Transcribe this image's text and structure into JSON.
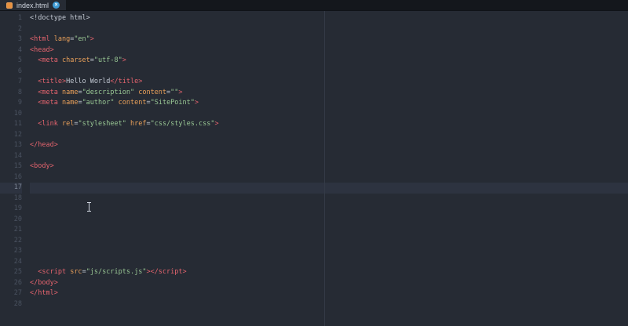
{
  "window": {
    "tab": {
      "title": "index.html",
      "icon": "html-file-icon",
      "close_glyph": "×"
    }
  },
  "editor": {
    "current_line": 17,
    "colors": {
      "plain": "#c2c8d2",
      "tag": "#e5646e",
      "attr": "#e9a05a",
      "string": "#99c794",
      "gutter": "#4a5260",
      "line_highlight": "#2d3340",
      "tab_close_blue": "#3e9bd5",
      "file_icon_orange": "#e8913f"
    },
    "lines": [
      {
        "n": 1,
        "s": [
          [
            "plain",
            "<!doctype html>"
          ]
        ]
      },
      {
        "n": 2,
        "s": []
      },
      {
        "n": 3,
        "s": [
          [
            "tag",
            "<html"
          ],
          [
            "attr",
            " lang"
          ],
          [
            "plain",
            "="
          ],
          [
            "string",
            "\"en\""
          ],
          [
            "tag",
            ">"
          ]
        ]
      },
      {
        "n": 4,
        "s": [
          [
            "tag",
            "<head>"
          ]
        ]
      },
      {
        "n": 5,
        "s": [
          [
            "plain",
            "  "
          ],
          [
            "tag",
            "<meta"
          ],
          [
            "attr",
            " charset"
          ],
          [
            "plain",
            "="
          ],
          [
            "string",
            "\"utf-8\""
          ],
          [
            "tag",
            ">"
          ]
        ]
      },
      {
        "n": 6,
        "s": []
      },
      {
        "n": 7,
        "s": [
          [
            "plain",
            "  "
          ],
          [
            "tag",
            "<title>"
          ],
          [
            "plain",
            "Hello World"
          ],
          [
            "tag",
            "</title>"
          ]
        ]
      },
      {
        "n": 8,
        "s": [
          [
            "plain",
            "  "
          ],
          [
            "tag",
            "<meta"
          ],
          [
            "attr",
            " name"
          ],
          [
            "plain",
            "="
          ],
          [
            "string",
            "\"description\""
          ],
          [
            "attr",
            " content"
          ],
          [
            "plain",
            "="
          ],
          [
            "string",
            "\"\""
          ],
          [
            "tag",
            ">"
          ]
        ]
      },
      {
        "n": 9,
        "s": [
          [
            "plain",
            "  "
          ],
          [
            "tag",
            "<meta"
          ],
          [
            "attr",
            " name"
          ],
          [
            "plain",
            "="
          ],
          [
            "string",
            "\"author\""
          ],
          [
            "attr",
            " content"
          ],
          [
            "plain",
            "="
          ],
          [
            "string",
            "\"SitePoint\""
          ],
          [
            "tag",
            ">"
          ]
        ]
      },
      {
        "n": 10,
        "s": []
      },
      {
        "n": 11,
        "s": [
          [
            "plain",
            "  "
          ],
          [
            "tag",
            "<link"
          ],
          [
            "attr",
            " rel"
          ],
          [
            "plain",
            "="
          ],
          [
            "string",
            "\"stylesheet\""
          ],
          [
            "attr",
            " href"
          ],
          [
            "plain",
            "="
          ],
          [
            "string",
            "\"css/styles.css\""
          ],
          [
            "tag",
            ">"
          ]
        ]
      },
      {
        "n": 12,
        "s": []
      },
      {
        "n": 13,
        "s": [
          [
            "tag",
            "</head>"
          ]
        ]
      },
      {
        "n": 14,
        "s": []
      },
      {
        "n": 15,
        "s": [
          [
            "tag",
            "<body>"
          ]
        ]
      },
      {
        "n": 16,
        "s": []
      },
      {
        "n": 17,
        "s": []
      },
      {
        "n": 18,
        "s": []
      },
      {
        "n": 19,
        "s": []
      },
      {
        "n": 20,
        "s": []
      },
      {
        "n": 21,
        "s": []
      },
      {
        "n": 22,
        "s": []
      },
      {
        "n": 23,
        "s": []
      },
      {
        "n": 24,
        "s": []
      },
      {
        "n": 25,
        "s": [
          [
            "plain",
            "  "
          ],
          [
            "tag",
            "<script"
          ],
          [
            "attr",
            " src"
          ],
          [
            "plain",
            "="
          ],
          [
            "string",
            "\"js/scripts.js\""
          ],
          [
            "tag",
            "></script>"
          ]
        ]
      },
      {
        "n": 26,
        "s": [
          [
            "tag",
            "</body>"
          ]
        ]
      },
      {
        "n": 27,
        "s": [
          [
            "tag",
            "</html>"
          ]
        ]
      },
      {
        "n": 28,
        "s": []
      }
    ]
  }
}
